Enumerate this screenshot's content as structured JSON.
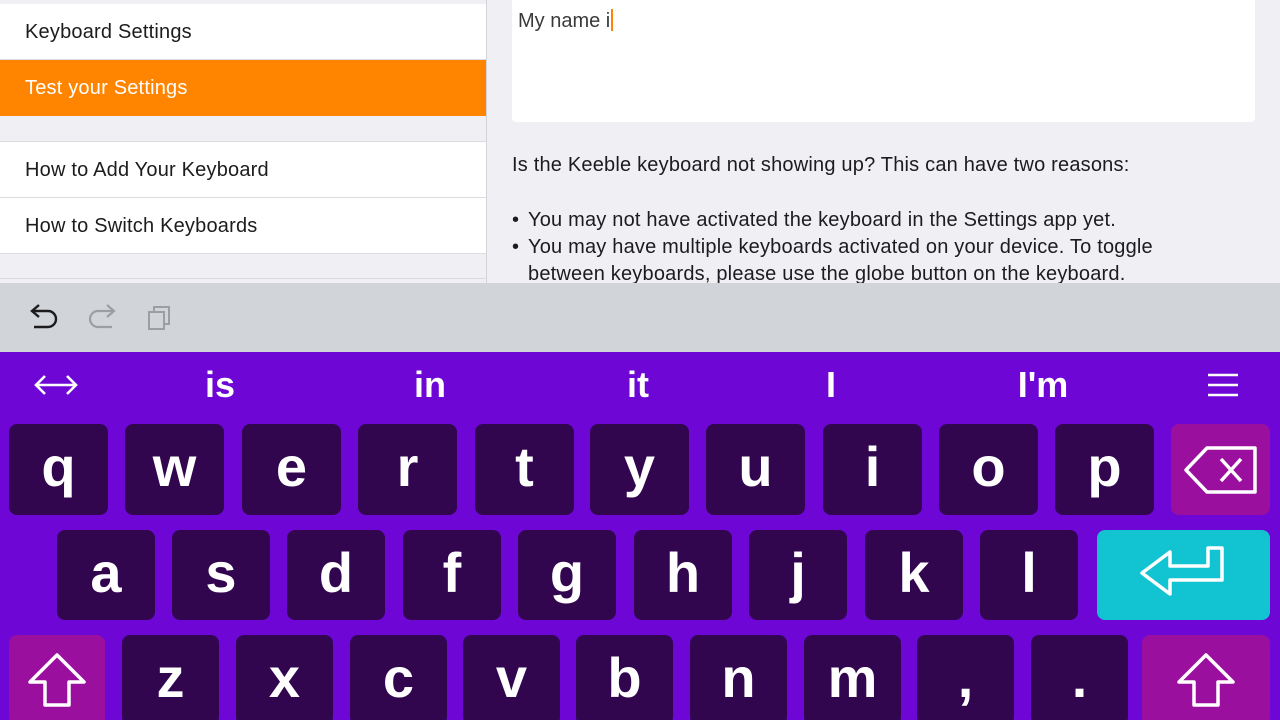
{
  "sidebar": {
    "items": [
      {
        "label": "Keyboard Settings",
        "active": false
      },
      {
        "label": "Test your Settings",
        "active": true
      },
      {
        "label": "How to Add Your Keyboard",
        "active": false
      },
      {
        "label": "How to Switch Keyboards",
        "active": false
      }
    ]
  },
  "editor": {
    "value": "My name i"
  },
  "info": {
    "intro": "Is the Keeble keyboard not showing up? This can have two reasons:",
    "bullet1": "You may not have activated the keyboard in the Settings app yet.",
    "bullet2": "You may have multiple keyboards activated on your device. To toggle between keyboards, please use the globe button on the keyboard."
  },
  "toolbar": {
    "undo_icon": "undo-icon",
    "redo_icon": "redo-icon",
    "copy_icon": "copy-icon"
  },
  "keyboard": {
    "suggestions": [
      "is",
      "in",
      "it",
      "I",
      "I'm"
    ],
    "row1": [
      "q",
      "w",
      "e",
      "r",
      "t",
      "y",
      "u",
      "i",
      "o",
      "p"
    ],
    "row2": [
      "a",
      "s",
      "d",
      "f",
      "g",
      "h",
      "j",
      "k",
      "l"
    ],
    "row3": [
      "z",
      "x",
      "c",
      "v",
      "b",
      "n",
      "m",
      ",",
      "."
    ],
    "colors": {
      "background": "#6e07d6",
      "key": "#31064f",
      "special_key": "#9a0f9e",
      "enter_key": "#12c3d1",
      "accent": "#ff8400"
    }
  }
}
